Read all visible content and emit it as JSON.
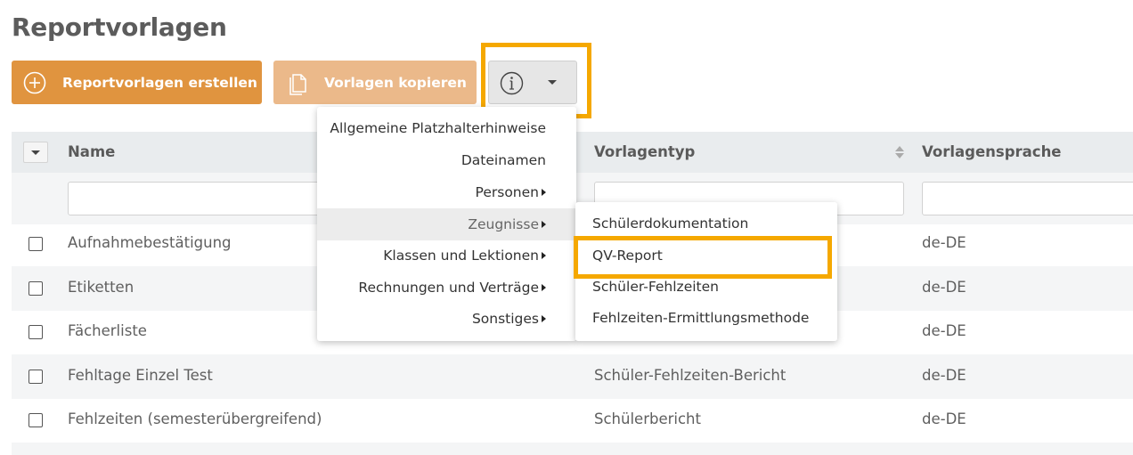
{
  "page": {
    "title": "Reportvorlagen"
  },
  "toolbar": {
    "create_label": "Reportvorlagen erstellen",
    "copy_label": "Vorlagen kopieren",
    "create_icon": "plus-circle-icon",
    "copy_icon": "copy-icon",
    "info_icon": "info-circle-icon"
  },
  "colors": {
    "accent": "#e0943f",
    "accent_disabled": "#ebb98a",
    "highlight": "#f5a800"
  },
  "table": {
    "columns": [
      "Name",
      "Vorlagentyp",
      "Vorlagensprache"
    ],
    "rows": [
      {
        "name": "Aufnahmebestätigung",
        "type": "",
        "lang": "de-DE"
      },
      {
        "name": "Etiketten",
        "type": "",
        "lang": "de-DE"
      },
      {
        "name": "Fächerliste",
        "type": "",
        "lang": "de-DE"
      },
      {
        "name": "Fehltage Einzel Test",
        "type": "Schüler-Fehlzeiten-Bericht",
        "lang": "de-DE"
      },
      {
        "name": "Fehlzeiten (semesterübergreifend)",
        "type": "Schülerbericht",
        "lang": "de-DE"
      }
    ]
  },
  "menu": {
    "items": [
      {
        "label": "Allgemeine Platzhalterhinweise"
      },
      {
        "label": "Dateinamen"
      },
      {
        "label": "Personen"
      },
      {
        "label": "Zeugnisse"
      },
      {
        "label": "Klassen und Lektionen"
      },
      {
        "label": "Rechnungen und Verträge"
      },
      {
        "label": "Sonstiges"
      }
    ],
    "active_item": "Zeugnisse"
  },
  "submenu": {
    "items": [
      {
        "label": "Schülerdokumentation"
      },
      {
        "label": "QV-Report"
      },
      {
        "label": "Schüler-Fehlzeiten"
      },
      {
        "label": "Fehlzeiten-Ermittlungsmethode"
      }
    ],
    "highlighted_item": "QV-Report"
  }
}
